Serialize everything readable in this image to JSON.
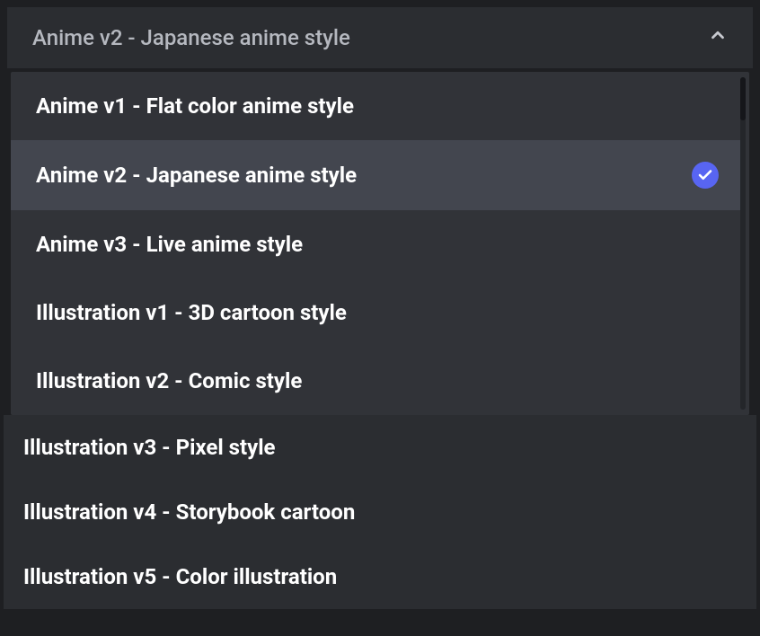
{
  "dropdown": {
    "selected_label": "Anime v2 - Japanese anime style",
    "options": [
      {
        "label": "Anime v1 - Flat color anime style",
        "selected": false
      },
      {
        "label": "Anime v2 - Japanese anime style",
        "selected": true
      },
      {
        "label": "Anime v3 - Live anime style",
        "selected": false
      },
      {
        "label": "Illustration v1 - 3D cartoon style",
        "selected": false
      },
      {
        "label": "Illustration v2 - Comic style",
        "selected": false
      }
    ],
    "overflow_options": [
      {
        "label": "Illustration v3 - Pixel style"
      },
      {
        "label": "Illustration v4 - Storybook cartoon"
      },
      {
        "label": "Illustration v5 - Color illustration"
      }
    ]
  }
}
